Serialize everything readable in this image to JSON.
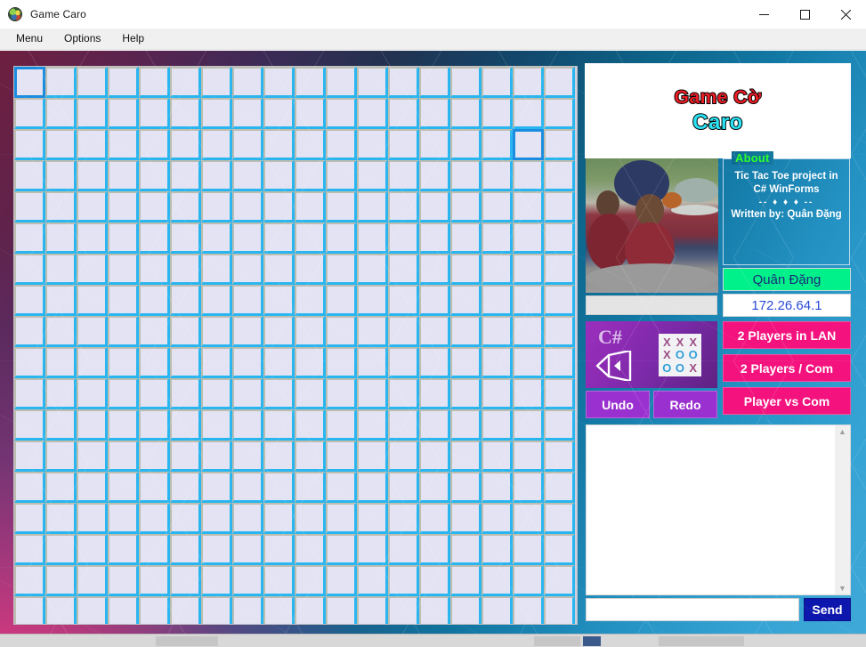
{
  "window": {
    "title": "Game Caro",
    "icon": "app-icon",
    "minimize": "—",
    "maximize": "□",
    "close": "✕"
  },
  "menubar": {
    "items": [
      {
        "label": "Menu"
      },
      {
        "label": "Options"
      },
      {
        "label": "Help"
      }
    ]
  },
  "board": {
    "columns": 18,
    "rows": 18,
    "cell_fill": "#e3e3f3",
    "cell_border": "#29b6f0",
    "highlight_border": "#1b8de0",
    "highlighted_cells": [
      {
        "row": 0,
        "col": 0
      },
      {
        "row": 2,
        "col": 16
      }
    ]
  },
  "panel": {
    "logo": {
      "line1": "Game Cờ",
      "line1_color": "#ee1c25",
      "line2": "Caro",
      "line2_color": "#29e3f5"
    },
    "photo": {
      "alt": "author-photo"
    },
    "about": {
      "legend": "About",
      "legend_color": "#2bff2b",
      "line1": "Tic Tac Toe project in",
      "line2": "C# WinForms",
      "separator": "-- ♦ ♦ ♦ --",
      "line3": "Written by: Quân Đặng"
    },
    "name_field": {
      "value": "Quân Đặng",
      "background": "#00f08a",
      "text_color": "#1a2a7a"
    },
    "ip_field": {
      "value": "172.26.64.1",
      "background": "#ffffff",
      "text_color": "#2a4ad6"
    },
    "grey_field": {
      "value": "",
      "placeholder": ""
    },
    "vs_card": {
      "csharp_label": "C#",
      "tictactoe": [
        "X",
        "X",
        "X",
        "X",
        "O",
        "O",
        "O",
        "O",
        "X"
      ],
      "tictactoe_kinds": [
        "x",
        "x",
        "x",
        "x",
        "o",
        "o",
        "o",
        "o",
        "x"
      ],
      "background": "#8c2bb3"
    },
    "buttons": {
      "undo": "Undo",
      "redo": "Redo",
      "lan": "2 Players in LAN",
      "com": "2 Players / Com",
      "pvc": "Player vs Com",
      "purple": "#9b30d0",
      "pink": "#f4137e"
    },
    "chat": {
      "messages": [],
      "input_value": "",
      "input_placeholder": "",
      "send_label": "Send",
      "send_color": "#0d17ad",
      "scroll_up": "▲",
      "scroll_down": "▼"
    }
  },
  "taskbar": {
    "items": [
      {
        "label": ""
      },
      {
        "label": ""
      },
      {
        "label": ""
      }
    ]
  }
}
